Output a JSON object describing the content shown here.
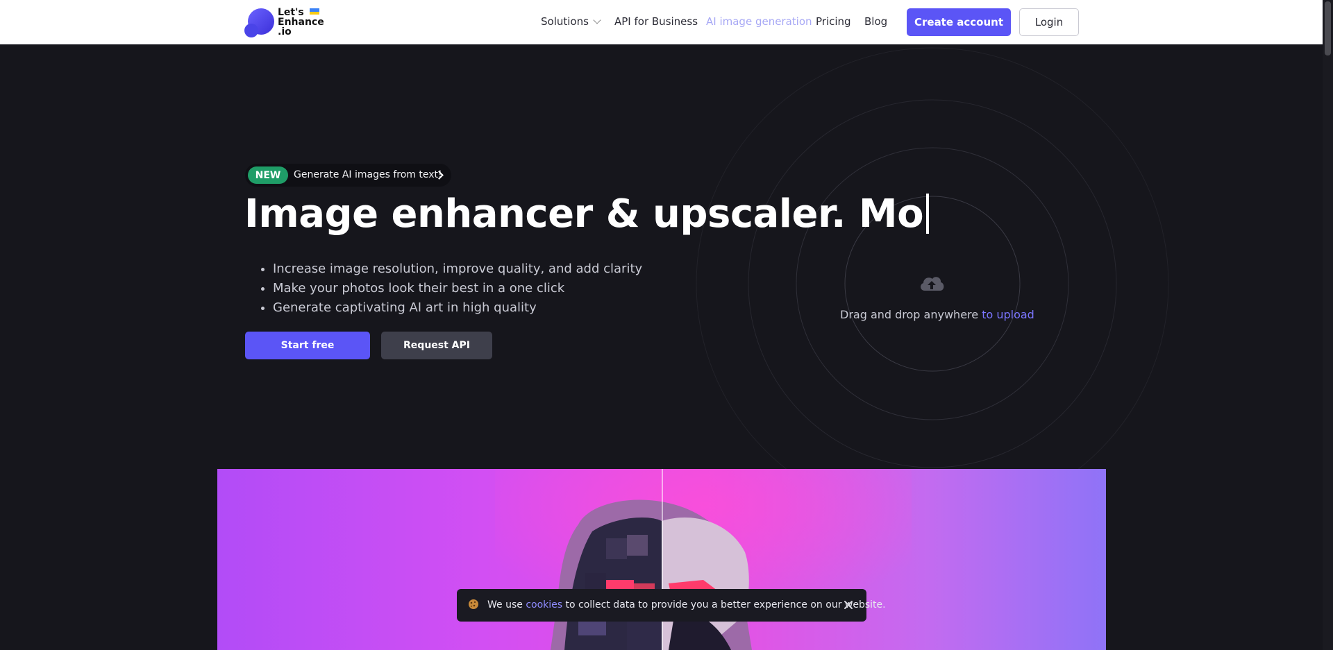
{
  "header": {
    "logo": {
      "line1": "Let's",
      "line2": "Enhance",
      "line3": ".io"
    },
    "nav": [
      {
        "label": "Solutions",
        "dropdown": true
      },
      {
        "label": "API for Business"
      },
      {
        "label": "AI image generation",
        "active": true
      },
      {
        "label": "Pricing"
      },
      {
        "label": "Blog"
      }
    ],
    "create_account": "Create account",
    "login": "Login"
  },
  "hero": {
    "badge_new": "NEW",
    "badge_text": "Generate AI images from text!",
    "title": "Image enhancer & upscaler. Mo",
    "bullets": [
      "Increase image resolution, improve quality, and add clarity",
      "Make your photos look their best in a one click",
      "Generate captivating AI art in high quality"
    ],
    "start_free": "Start free",
    "request_api": "Request API"
  },
  "upload": {
    "drag_text": "Drag and drop anywhere ",
    "link_text": "to upload",
    "icon": "cloud-upload-icon"
  },
  "cookie": {
    "prefix": "We use ",
    "link": "cookies",
    "suffix": " to collect data to provide you a better experience on our website."
  },
  "colors": {
    "accent": "#5b55f6",
    "background": "#16161c",
    "new_badge": "#1f9d67"
  }
}
